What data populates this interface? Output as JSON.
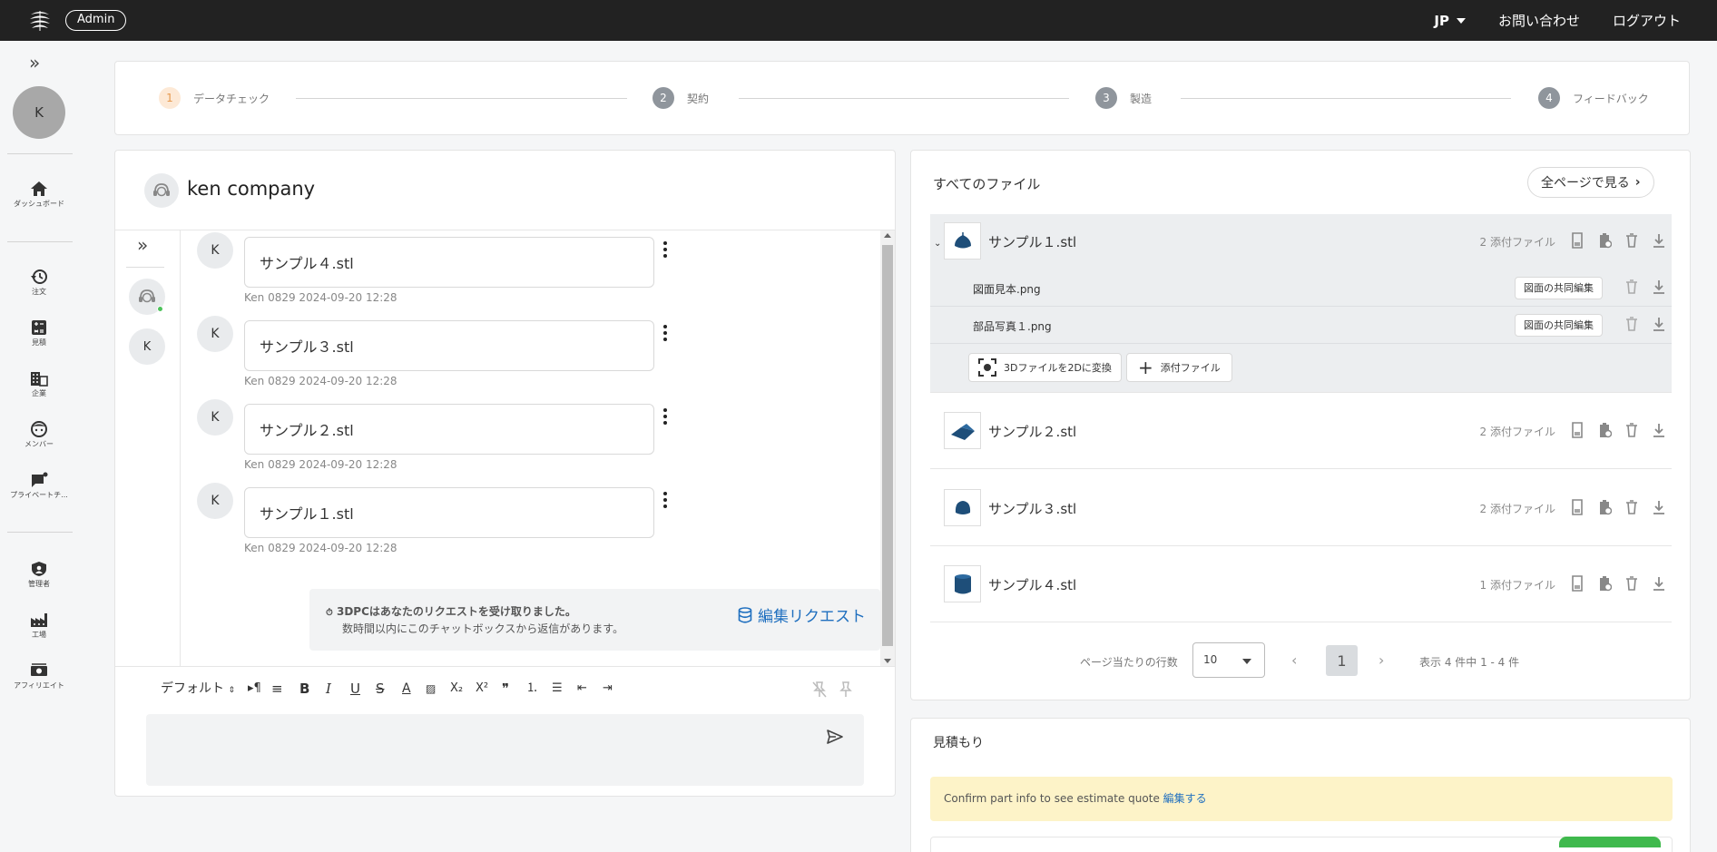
{
  "topbar": {
    "admin_label": "Admin",
    "lang": "JP",
    "contact": "お問い合わせ",
    "logout": "ログアウト"
  },
  "sidebar": {
    "avatar_initial": "K",
    "items": [
      {
        "label": "ダッシュボード",
        "icon": "home-icon"
      },
      {
        "label": "注文",
        "icon": "history-icon"
      },
      {
        "label": "見積",
        "icon": "calculator-icon"
      },
      {
        "label": "企業",
        "icon": "building-icon"
      },
      {
        "label": "メンバー",
        "icon": "face-icon"
      },
      {
        "label": "プライベートチ...",
        "icon": "chat-bubble-icon"
      },
      {
        "label": "管理者",
        "icon": "shield-user-icon"
      },
      {
        "label": "工場",
        "icon": "factory-icon"
      },
      {
        "label": "アフィリエイト",
        "icon": "money-icon"
      }
    ]
  },
  "stepper": {
    "steps": [
      {
        "num": "1",
        "label": "データチェック"
      },
      {
        "num": "2",
        "label": "契約"
      },
      {
        "num": "3",
        "label": "製造"
      },
      {
        "num": "4",
        "label": "フィードバック"
      }
    ]
  },
  "chat": {
    "company_name": "ken company",
    "members": [
      "K"
    ],
    "messages": [
      {
        "avatar": "K",
        "text": "サンプル４.stl",
        "meta": "Ken 0829  2024-09-20 12:28"
      },
      {
        "avatar": "K",
        "text": "サンプル３.stl",
        "meta": "Ken 0829  2024-09-20 12:28"
      },
      {
        "avatar": "K",
        "text": "サンプル２.stl",
        "meta": "Ken 0829  2024-09-20 12:28"
      },
      {
        "avatar": "K",
        "text": "サンプル１.stl",
        "meta": "Ken 0829  2024-09-20 12:28"
      }
    ],
    "notice_line1": "3DPCはあなたのリクエストを受け取りました。",
    "notice_line2": "数時間以内にこのチャットボックスから返信があります。",
    "edit_request": "編集リクエスト",
    "toolbar": {
      "font_select": "デフォルト",
      "bold": "B",
      "italic": "I",
      "underline": "U",
      "strike": "S",
      "font_color": "A",
      "subscript": "X₂",
      "superscript": "X²",
      "quote": "❞"
    }
  },
  "files": {
    "title": "すべてのファイル",
    "view_all": "全ページで見る",
    "rows": [
      {
        "name": "サンプル１.stl",
        "attach": "2 添付ファイル"
      },
      {
        "name": "サンプル２.stl",
        "attach": "2 添付ファイル"
      },
      {
        "name": "サンプル３.stl",
        "attach": "2 添付ファイル"
      },
      {
        "name": "サンプル４.stl",
        "attach": "1 添付ファイル"
      }
    ],
    "attachments": [
      {
        "name": "図面見本.png",
        "button": "図面の共同編集"
      },
      {
        "name": "部品写真１.png",
        "button": "図面の共同編集"
      }
    ],
    "convert_button": "3Dファイルを2Dに変換",
    "attach_button": "添付ファイル",
    "pagination": {
      "rows_label": "ページ当たりの行数",
      "rows_value": "10",
      "current_page": "1",
      "info": "表示 4 件中 1 - 4 件"
    }
  },
  "estimate": {
    "title": "見積もり",
    "notice": "Confirm part info to see estimate quote",
    "notice_link": "編集する"
  },
  "colors": {
    "topbar": "#222222",
    "accent_blue": "#1f6fbf",
    "step_active": "#e69a4f",
    "file_thumb": "#1e4e79"
  }
}
